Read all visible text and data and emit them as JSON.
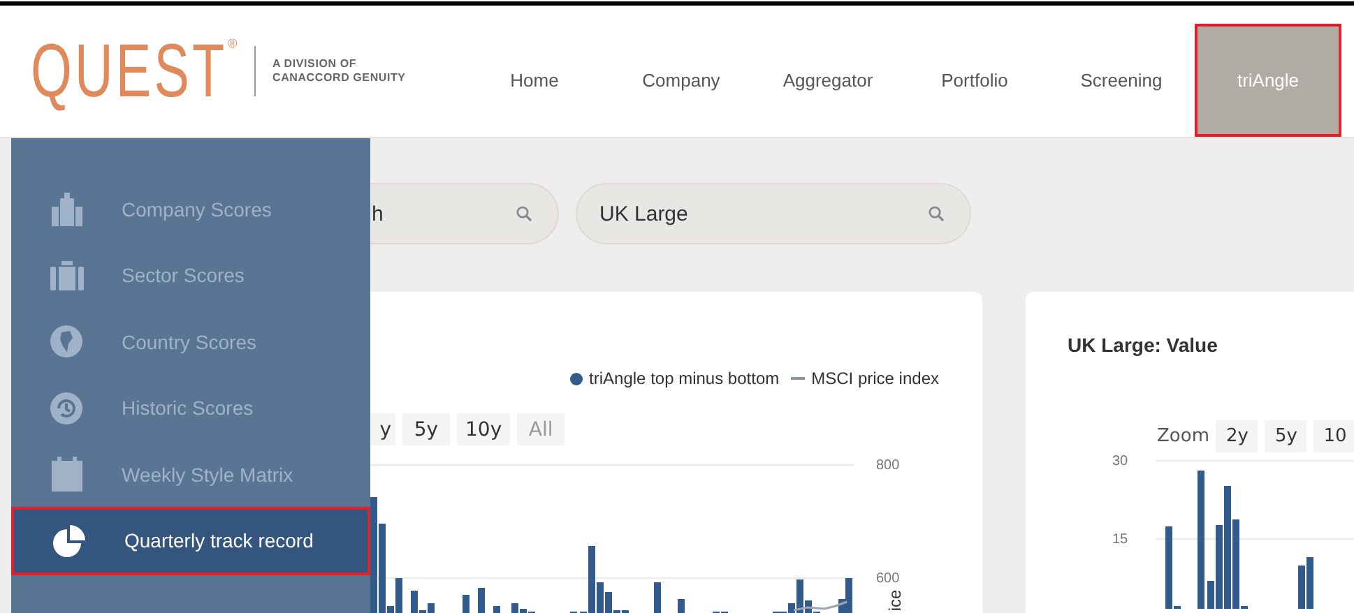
{
  "header": {
    "logo": "QUEST",
    "registered": "®",
    "tagline_lines": [
      "A DIVISION OF",
      "CANACCORD GENUITY"
    ]
  },
  "nav": [
    {
      "label": "Home",
      "selected": false
    },
    {
      "label": "Company",
      "selected": false
    },
    {
      "label": "Aggregator",
      "selected": false
    },
    {
      "label": "Portfolio",
      "selected": false
    },
    {
      "label": "Screening",
      "selected": false
    },
    {
      "label": "triAngle",
      "selected": true
    }
  ],
  "sidebar": {
    "items": [
      {
        "label": "Company Scores",
        "selected": false
      },
      {
        "label": "Sector Scores",
        "selected": false
      },
      {
        "label": "Country Scores",
        "selected": false
      },
      {
        "label": "Historic Scores",
        "selected": false
      },
      {
        "label": "Weekly Style Matrix",
        "selected": false
      },
      {
        "label": "Quarterly track record",
        "selected": true
      }
    ]
  },
  "search_fields": [
    {
      "value": "h"
    },
    {
      "value": "UK Large"
    }
  ],
  "left_card": {
    "legend": [
      {
        "kind": "dot",
        "label": "triAngle top minus bottom"
      },
      {
        "kind": "line",
        "label": "MSCI price index"
      }
    ],
    "zoom_buttons": [
      {
        "label": "y",
        "disabled": false
      },
      {
        "label": "5y",
        "disabled": false
      },
      {
        "label": "10y",
        "disabled": false
      },
      {
        "label": "All",
        "disabled": true
      }
    ],
    "right_ticks": [
      "800",
      "600"
    ],
    "axis_title": "ice"
  },
  "right_card": {
    "title": "UK Large: Value",
    "zoom_label": "Zoom",
    "zoom_buttons": [
      {
        "label": "2y",
        "disabled": false
      },
      {
        "label": "5y",
        "disabled": false
      },
      {
        "label": "10",
        "disabled": false
      }
    ],
    "left_ticks": [
      "30",
      "15"
    ]
  }
}
